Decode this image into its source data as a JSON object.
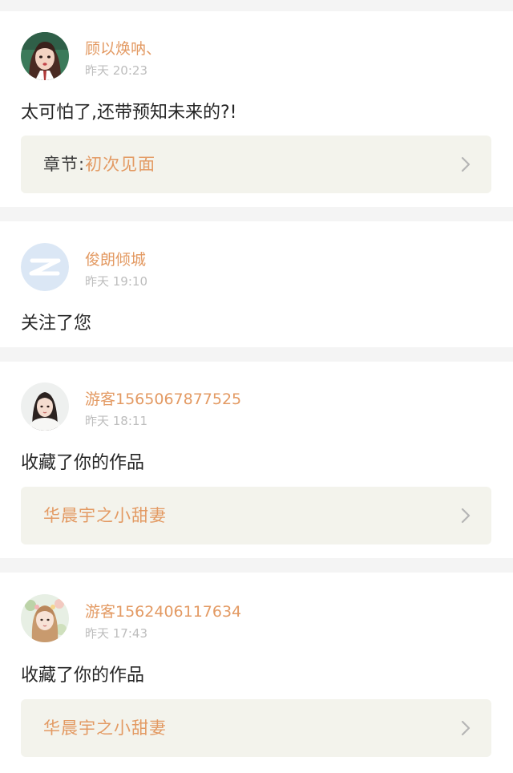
{
  "notifications": [
    {
      "username": "顾以焕呐、",
      "time": "昨天 20:23",
      "message": "太可怕了,还带预知未来的?!",
      "reference": {
        "label": "章节:",
        "value": "初次见面"
      },
      "avatar_icon": "user-photo-avatar"
    },
    {
      "username": "俊朗倾城",
      "time": "昨天 19:10",
      "message": "关注了您",
      "avatar_icon": "default-z-avatar"
    },
    {
      "username": "游客1565067877525",
      "time": "昨天 18:11",
      "message": "收藏了你的作品",
      "reference": {
        "title": "华晨宇之小甜妻"
      },
      "avatar_icon": "user-photo-avatar"
    },
    {
      "username": "游客1562406117634",
      "time": "昨天 17:43",
      "message": "收藏了你的作品",
      "reference": {
        "title": "华晨宇之小甜妻"
      },
      "avatar_icon": "user-photo-avatar"
    }
  ],
  "colors": {
    "accent": "#e39a63",
    "page_background": "#f4f4f4",
    "card_background": "#ffffff",
    "reference_background": "#f3f3ec",
    "time_text": "#bdbdbd",
    "body_text": "#262626"
  },
  "icons": {
    "chevron": "chevron-right-icon"
  }
}
